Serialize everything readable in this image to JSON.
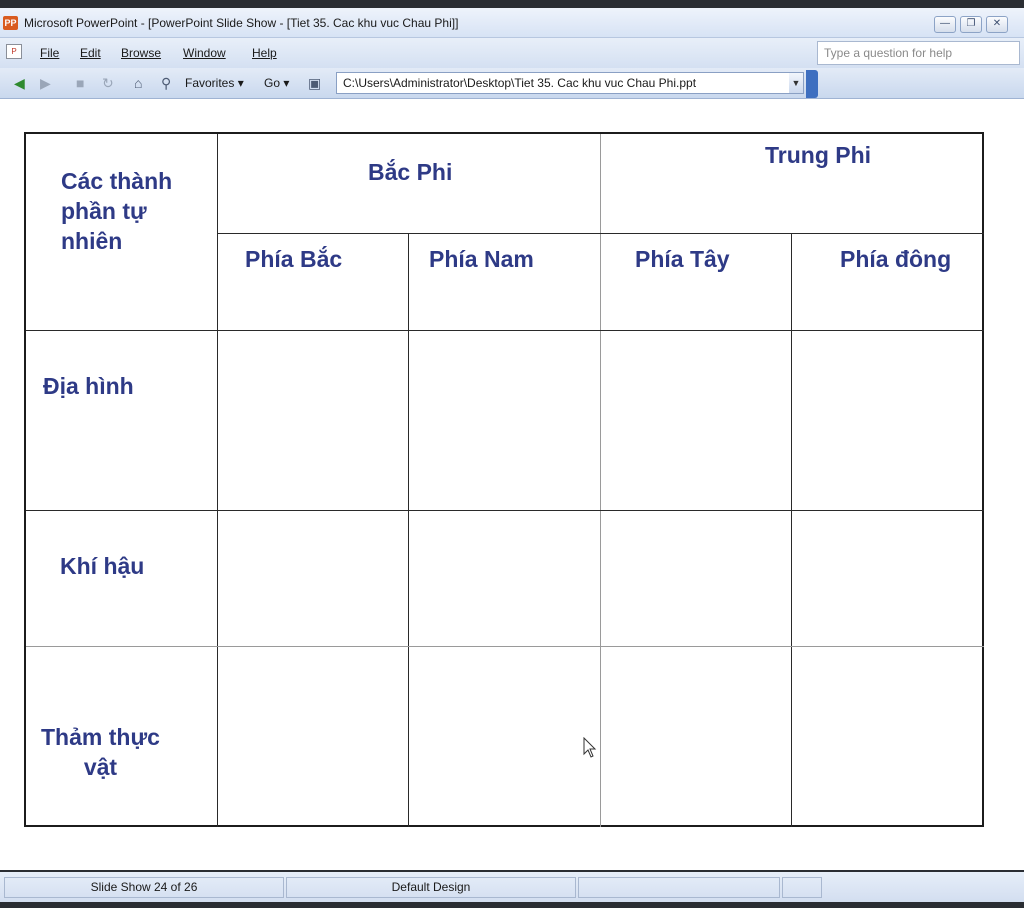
{
  "window": {
    "app_icon": "PP",
    "title": "Microsoft PowerPoint - [PowerPoint Slide Show - [Tiet 35. Cac khu vuc Chau Phi]]"
  },
  "menu": {
    "items": [
      "File",
      "Edit",
      "Browse",
      "Window",
      "Help"
    ],
    "help_placeholder": "Type a question for help"
  },
  "toolbar": {
    "favorites_label": "Favorites",
    "go_label": "Go",
    "address": "C:\\Users\\Administrator\\Desktop\\Tiet 35. Cac khu vuc Chau Phi.ppt",
    "icons": [
      "back-icon",
      "forward-icon",
      "stop-icon",
      "refresh-icon",
      "home-icon",
      "search-icon",
      "slideshow-icon"
    ]
  },
  "slide": {
    "table": {
      "corner_header": [
        "Các thành",
        "phần tự",
        "nhiên"
      ],
      "group_headers": [
        "Bắc Phi",
        "Trung Phi"
      ],
      "sub_headers": [
        "Phía Bắc",
        "Phía Nam",
        "Phía Tây",
        "Phía đông"
      ],
      "row_headers": [
        [
          "Địa hình"
        ],
        [
          "Khí hậu"
        ],
        [
          "Thảm thực",
          "vật"
        ]
      ],
      "text_color": "#2e3a86"
    }
  },
  "status": {
    "slide_position": "Slide Show 24 of 26",
    "design": "Default Design"
  }
}
